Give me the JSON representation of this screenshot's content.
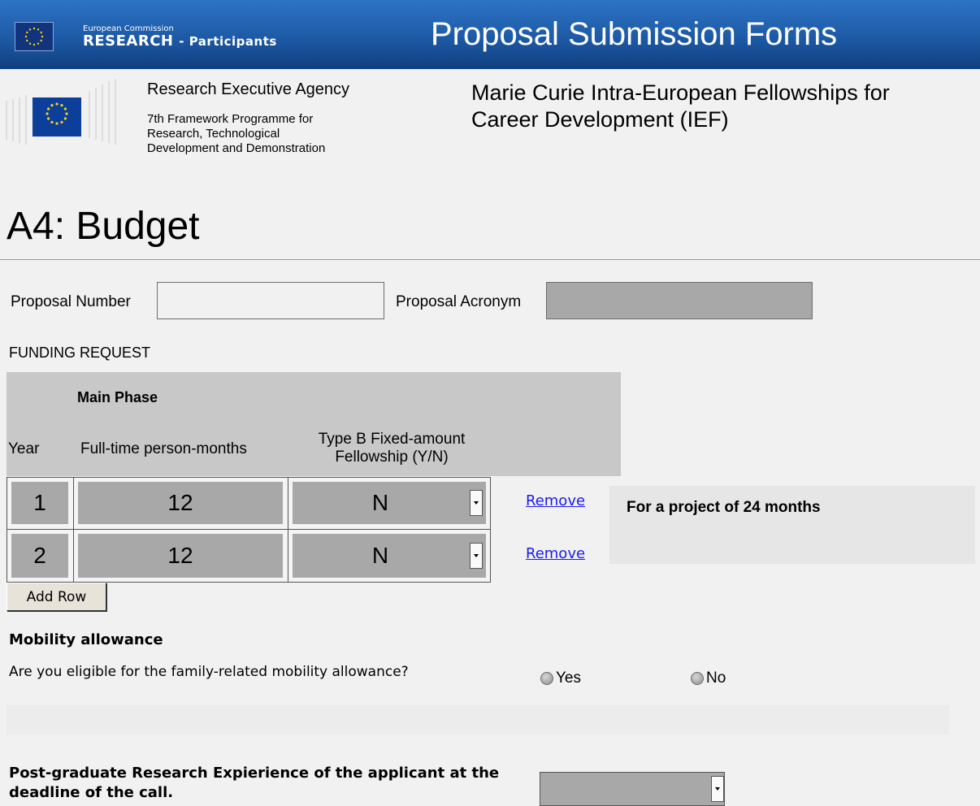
{
  "banner": {
    "org_line1": "European Commission",
    "org_line2_main": "RESEARCH",
    "org_line2_suffix": "- Participants",
    "title": "Proposal Submission Forms"
  },
  "agency": {
    "name": "Research Executive Agency",
    "fp_line1": "7th Framework Programme for",
    "fp_line2": "Research, Technological",
    "fp_line3": "Development and Demonstration"
  },
  "programme": {
    "line1": "Marie Curie Intra-European Fellowships for",
    "line2": "Career Development (IEF)"
  },
  "page_title": "A4: Budget",
  "proposal": {
    "number_label": "Proposal Number",
    "number_value": "",
    "acronym_label": "Proposal Acronym",
    "acronym_value": ""
  },
  "funding": {
    "heading": "FUNDING REQUEST",
    "phase": "Main Phase",
    "columns": {
      "year": "Year",
      "months": "Full-time person-months",
      "type_b_line1": "Type B Fixed-amount",
      "type_b_line2": "Fellowship (Y/N)"
    },
    "rows": [
      {
        "year": "1",
        "months": "12",
        "type_b": "N",
        "remove": "Remove"
      },
      {
        "year": "2",
        "months": "12",
        "type_b": "N",
        "remove": "Remove"
      }
    ],
    "note": "For a project of 24 months",
    "add_row": "Add Row"
  },
  "mobility": {
    "heading": "Mobility allowance",
    "question": "Are you eligible for the family-related mobility allowance?",
    "yes": "Yes",
    "no": "No"
  },
  "postgrad": {
    "label_line1": "Post-graduate Research Expierience of the applicant at the",
    "label_line2": "deadline of the call.",
    "selected": ""
  }
}
